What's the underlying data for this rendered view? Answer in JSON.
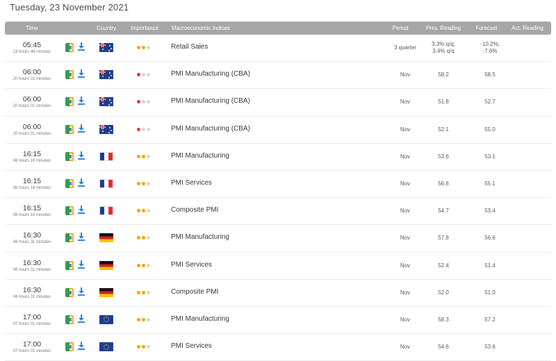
{
  "date_title": "Tuesday, 23 November 2021",
  "headers": {
    "time": "Time",
    "country": "Country",
    "importance": "Importance",
    "indices": "Macroeconomic Indices",
    "period": "Period",
    "prev": "Prev. Reading",
    "forecast": "Forecast",
    "actual": "Act. Reading"
  },
  "colors": {
    "importance_high": "#f0a500",
    "importance_low_red": "#e03535",
    "importance_off": "#d5d5d5",
    "header_bg": "#a7a7a7"
  },
  "icons": {
    "calendar": "add-to-calendar-icon",
    "download": "download-icon"
  },
  "rows": [
    {
      "time": "05:45",
      "remaining": "19 hours 46 minutes",
      "country": "australia",
      "importance": "medium",
      "indicator": "Retail Sales",
      "period": "3 quarter",
      "prev": [
        "3.3% q/q;",
        "3.4% q/q"
      ],
      "forecast": [
        "-10.2%;",
        "-7.6%"
      ],
      "actual": ""
    },
    {
      "time": "06:00",
      "remaining": "20 hours 01 minutes",
      "country": "australia",
      "importance": "low",
      "indicator": "PMI Manufacturing (CBA)",
      "period": "Nov",
      "prev": "58.2",
      "forecast": "58.5",
      "actual": ""
    },
    {
      "time": "06:00",
      "remaining": "20 hours 01 minutes",
      "country": "australia",
      "importance": "low",
      "indicator": "PMI Manufacturing (CBA)",
      "period": "Nov",
      "prev": "51.8",
      "forecast": "52.7",
      "actual": ""
    },
    {
      "time": "06:00",
      "remaining": "20 hours 01 minutes",
      "country": "australia",
      "importance": "low",
      "indicator": "PMI Manufacturing (CBA)",
      "period": "Nov",
      "prev": "52.1",
      "forecast": "55.0",
      "actual": ""
    },
    {
      "time": "16:15",
      "remaining": "06 hours 16 minutes",
      "country": "france",
      "importance": "medium",
      "indicator": "PMI Manufacturing",
      "period": "Nov",
      "prev": "53.6",
      "forecast": "53.1",
      "actual": ""
    },
    {
      "time": "16:15",
      "remaining": "06 hours 16 minutes",
      "country": "france",
      "importance": "medium",
      "indicator": "PMI Services",
      "period": "Nov",
      "prev": "56.6",
      "forecast": "55.1",
      "actual": ""
    },
    {
      "time": "16:15",
      "remaining": "06 hours 16 minutes",
      "country": "france",
      "importance": "medium",
      "indicator": "Composite PMI",
      "period": "Nov",
      "prev": "54.7",
      "forecast": "53.4",
      "actual": ""
    },
    {
      "time": "16:30",
      "remaining": "06 hours 31 minutes",
      "country": "germany",
      "importance": "medium",
      "indicator": "PMI Manufacturing",
      "period": "Nov",
      "prev": "57.8",
      "forecast": "56.6",
      "actual": ""
    },
    {
      "time": "16:30",
      "remaining": "06 hours 31 minutes",
      "country": "germany",
      "importance": "medium",
      "indicator": "PMI Services",
      "period": "Nov",
      "prev": "52.4",
      "forecast": "51.4",
      "actual": ""
    },
    {
      "time": "16:30",
      "remaining": "06 hours 31 minutes",
      "country": "germany",
      "importance": "medium",
      "indicator": "Composite PMI",
      "period": "Nov",
      "prev": "52.0",
      "forecast": "51.0",
      "actual": ""
    },
    {
      "time": "17:00",
      "remaining": "07 hours 01 minutes",
      "country": "eurozone",
      "importance": "medium",
      "indicator": "PMI Manufacturing",
      "period": "Nov",
      "prev": "58.3",
      "forecast": "57.2",
      "actual": ""
    },
    {
      "time": "17:00",
      "remaining": "07 hours 01 minutes",
      "country": "eurozone",
      "importance": "medium",
      "indicator": "PMI Services",
      "period": "Nov",
      "prev": "54.6",
      "forecast": "53.6",
      "actual": ""
    }
  ]
}
